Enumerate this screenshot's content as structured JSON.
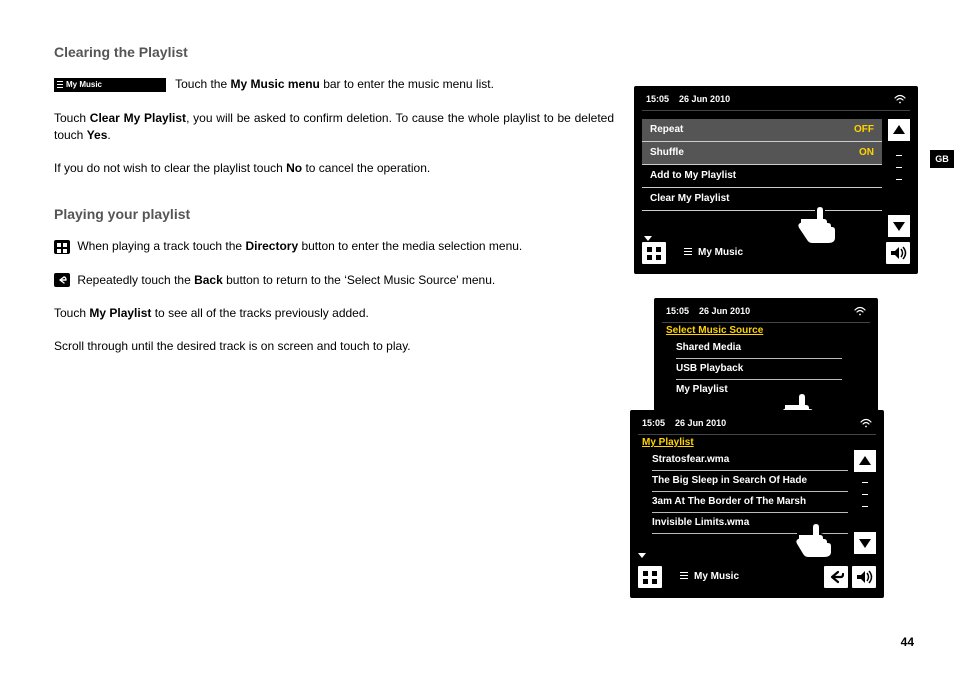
{
  "page": {
    "region_code": "GB",
    "page_number": "44"
  },
  "text": {
    "heading1": "Clearing the Playlist",
    "heading2": "Playing your playlist",
    "my_music_bar": "My Music",
    "p1_suffix": " Touch the ",
    "p1_bold": "My Music menu",
    "p1_end": " bar to enter the music menu list.",
    "p2_a": "Touch ",
    "p2_bold": "Clear My Playlist",
    "p2_b": ", you will be asked to confirm deletion. To cause the whole playlist to be deleted touch ",
    "p2_bold2": "Yes",
    "p2_c": ".",
    "p3_a": "If you do not wish to clear the playlist touch ",
    "p3_bold": "No",
    "p3_b": " to cancel the operation.",
    "p4_a": " When playing a track touch the ",
    "p4_bold": "Directory",
    "p4_b": " button to enter the media selection menu.",
    "p5_a": " Repeatedly touch the ",
    "p5_bold": "Back",
    "p5_b": " button to return to the ‘Select Music Source' menu.",
    "p6_a": "Touch ",
    "p6_bold": "My Playlist",
    "p6_b": " to see all of the tracks previously added.",
    "p7": "Scroll through until the desired track is on screen and touch to play."
  },
  "device1": {
    "time": "15:05",
    "date": "26 Jun 2010",
    "items": [
      {
        "label": "Repeat",
        "value": "OFF"
      },
      {
        "label": "Shuffle",
        "value": "ON"
      },
      {
        "label": "Add to My Playlist",
        "value": ""
      },
      {
        "label": "Clear My Playlist",
        "value": ""
      }
    ],
    "footer": "My Music"
  },
  "device2": {
    "time": "15:05",
    "date": "26 Jun 2010",
    "header": "Select Music Source",
    "items": [
      "Shared Media",
      "USB Playback",
      "My Playlist"
    ]
  },
  "device3": {
    "time": "15:05",
    "date": "26 Jun 2010",
    "header": "My Playlist",
    "items": [
      "Stratosfear.wma",
      "The Big Sleep in Search Of Hade",
      "3am At The Border of The Marsh",
      "Invisible Limits.wma"
    ],
    "footer": "My Music"
  }
}
